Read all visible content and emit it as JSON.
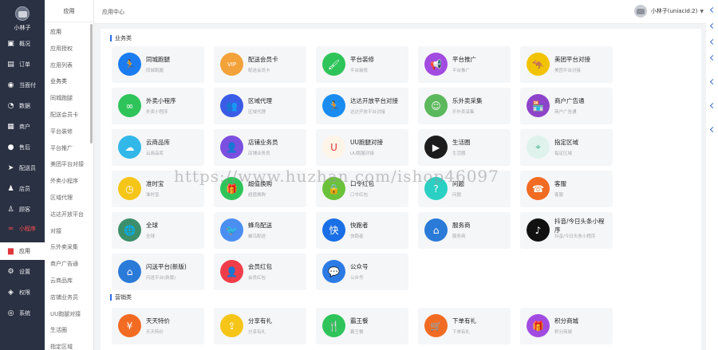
{
  "sidebar": {
    "username": "小林子",
    "items": [
      {
        "label": "概况",
        "icon": "overview-icon",
        "glyph": "▣",
        "style": ""
      },
      {
        "label": "订单",
        "icon": "order-icon",
        "glyph": "▤",
        "style": ""
      },
      {
        "label": "当面付",
        "icon": "face-pay-icon",
        "glyph": "◉",
        "style": ""
      },
      {
        "label": "数据",
        "icon": "data-icon",
        "glyph": "◔",
        "style": ""
      },
      {
        "label": "商户",
        "icon": "merchant-icon",
        "glyph": "▦",
        "style": ""
      },
      {
        "label": "售后",
        "icon": "after-sales-icon",
        "glyph": "●",
        "style": ""
      },
      {
        "label": "配送员",
        "icon": "courier-icon",
        "glyph": "➤",
        "style": ""
      },
      {
        "label": "店员",
        "icon": "clerk-icon",
        "glyph": "♟",
        "style": ""
      },
      {
        "label": "顾客",
        "icon": "customer-icon",
        "glyph": "♙",
        "style": ""
      },
      {
        "label": "小程序",
        "icon": "miniprogram-icon",
        "glyph": "∞",
        "style": "red"
      },
      {
        "label": "应用",
        "icon": "app-icon",
        "glyph": "▆",
        "style": "active"
      },
      {
        "label": "设置",
        "icon": "settings-icon",
        "glyph": "⚙",
        "style": ""
      },
      {
        "label": "权限",
        "icon": "permission-icon",
        "glyph": "◈",
        "style": ""
      },
      {
        "label": "系统",
        "icon": "system-icon",
        "glyph": "◎",
        "style": ""
      }
    ]
  },
  "submenu": {
    "header": "应用",
    "entries": [
      {
        "label": "应用",
        "kind": "cat"
      },
      {
        "label": "应用授权",
        "kind": "link"
      },
      {
        "label": "应用列表",
        "kind": "link"
      },
      {
        "label": "业务类",
        "kind": "cat"
      },
      {
        "label": "同城跑腿",
        "kind": "link"
      },
      {
        "label": "配送会员卡",
        "kind": "link"
      },
      {
        "label": "平台装修",
        "kind": "link"
      },
      {
        "label": "平台推广",
        "kind": "link"
      },
      {
        "label": "美团平台对接",
        "kind": "link"
      },
      {
        "label": "外卖小程序",
        "kind": "link"
      },
      {
        "label": "区域代理",
        "kind": "link"
      },
      {
        "label": "达达开放平台",
        "kind": "link"
      },
      {
        "label": "对接",
        "kind": "link"
      },
      {
        "label": "乐外卖采集",
        "kind": "link"
      },
      {
        "label": "商户广告通",
        "kind": "link"
      },
      {
        "label": "云商品库",
        "kind": "link"
      },
      {
        "label": "店铺业务员",
        "kind": "link"
      },
      {
        "label": "UU跑腿对接",
        "kind": "link"
      },
      {
        "label": "生活圈",
        "kind": "link"
      },
      {
        "label": "指定区域",
        "kind": "link"
      }
    ]
  },
  "topbar": {
    "title": "应用中心",
    "user": "小林子(uniacid:2)",
    "caret": "▼"
  },
  "sections": [
    {
      "title": "业务类"
    },
    {
      "title": "营销类"
    }
  ],
  "tiles": [
    {
      "name": "同城跑腿",
      "desc": "同城跑腿",
      "icon": "running-man-icon",
      "glyph": "🏃",
      "color": "#1a7cf0"
    },
    {
      "name": "配送会员卡",
      "desc": "配送会员卡",
      "icon": "vip-card-icon",
      "glyph": "VIP",
      "color": "#f3a23a"
    },
    {
      "name": "平台装修",
      "desc": "平台装修",
      "icon": "brush-icon",
      "glyph": "🖌",
      "color": "#2fc45a"
    },
    {
      "name": "平台推广",
      "desc": "平台推广",
      "icon": "megaphone-icon",
      "glyph": "📢",
      "color": "#a24be0"
    },
    {
      "name": "美团平台对接",
      "desc": "美团平台对接",
      "icon": "kangaroo-icon",
      "glyph": "🦘",
      "color": "#f2c300"
    },
    {
      "name": "外卖小程序",
      "desc": "外卖小程序",
      "icon": "miniprogram-logo-icon",
      "glyph": "∞",
      "color": "#2fc45a"
    },
    {
      "name": "区域代理",
      "desc": "区域代理",
      "icon": "agents-icon",
      "glyph": "👥",
      "color": "#3a5ce6"
    },
    {
      "name": "达达开放平台对接",
      "desc": "达达开放平台对接",
      "icon": "dada-icon",
      "glyph": "🏃",
      "color": "#1a8cf0"
    },
    {
      "name": "乐外卖采集",
      "desc": "乐外卖采集",
      "icon": "lewaimai-icon",
      "glyph": "☺",
      "color": "#5cb85c"
    },
    {
      "name": "商户广告通",
      "desc": "商户广告通",
      "icon": "store-ad-icon",
      "glyph": "🏪",
      "color": "#8e44c9"
    },
    {
      "name": "云商品库",
      "desc": "云商品库",
      "icon": "cloud-icon",
      "glyph": "☁",
      "color": "#32b8e8"
    },
    {
      "name": "店铺业务员",
      "desc": "店铺业务员",
      "icon": "salesman-icon",
      "glyph": "👤",
      "color": "#7b4fe0"
    },
    {
      "name": "UU跑腿对接",
      "desc": "UU跑腿对接",
      "icon": "magnet-icon",
      "glyph": "U",
      "color": "#fff4e8"
    },
    {
      "name": "生活圈",
      "desc": "生活圈",
      "icon": "play-circle-icon",
      "glyph": "▶",
      "color": "#1c1c1c"
    },
    {
      "name": "指定区域",
      "desc": "指定区域",
      "icon": "location-pin-icon",
      "glyph": "⌖",
      "color": "#dff3ec"
    },
    {
      "name": "准时宝",
      "desc": "准时宝",
      "icon": "clock-icon",
      "glyph": "◷",
      "color": "#f5c518"
    },
    {
      "name": "超值换购",
      "desc": "超值换购",
      "icon": "gift-icon",
      "glyph": "🎁",
      "color": "#2fc45a"
    },
    {
      "name": "口令红包",
      "desc": "口令红包",
      "icon": "lock-icon",
      "glyph": "🔒",
      "color": "#6bc23a"
    },
    {
      "name": "问题",
      "desc": "问题",
      "icon": "question-icon",
      "glyph": "?",
      "color": "#2ad0c4"
    },
    {
      "name": "客服",
      "desc": "客服",
      "icon": "service-icon",
      "glyph": "☎",
      "color": "#f26b22"
    },
    {
      "name": "全球",
      "desc": "全球",
      "icon": "globe-icon",
      "glyph": "🌐",
      "color": "#3c8f6b"
    },
    {
      "name": "蜂鸟配送",
      "desc": "蜂鸟配送",
      "icon": "hummingbird-icon",
      "glyph": "🐦",
      "color": "#4b8ef2"
    },
    {
      "name": "快跑者",
      "desc": "快跑者",
      "icon": "kuaipaozhe-icon",
      "glyph": "快",
      "color": "#1a6fe6"
    },
    {
      "name": "服务商",
      "desc": "服务商",
      "icon": "service-provider-icon",
      "glyph": "⌂",
      "color": "#2a7ad8"
    },
    {
      "name": "抖音/今日头条小程序",
      "desc": "抖音/今日头条小程序",
      "icon": "tiktok-icon",
      "glyph": "♪",
      "color": "#111"
    },
    {
      "name": "闪送平台(新版)",
      "desc": "闪送平台(新版)",
      "icon": "shansong-icon",
      "glyph": "⌂",
      "color": "#2a7ad8"
    },
    {
      "name": "会员红包",
      "desc": "会员红包",
      "icon": "red-packet-icon",
      "glyph": "👤",
      "color": "#ef3e4a"
    },
    {
      "name": "公众号",
      "desc": "公众号",
      "icon": "chat-icon",
      "glyph": "💬",
      "color": "#2c7be5"
    },
    {
      "name": "天天特价",
      "desc": "天天特价",
      "icon": "special-offer-icon",
      "glyph": "¥",
      "color": "#f26b22"
    },
    {
      "name": "分享有礼",
      "desc": "分享有礼",
      "icon": "share-icon",
      "glyph": "⇪",
      "color": "#f5c518"
    },
    {
      "name": "霸王餐",
      "desc": "霸王餐",
      "icon": "meal-icon",
      "glyph": "🍴",
      "color": "#2fc45a"
    },
    {
      "name": "下单有礼",
      "desc": "下单有礼",
      "icon": "cart-icon",
      "glyph": "🛒",
      "color": "#f26b22"
    },
    {
      "name": "积分商城",
      "desc": "积分商城",
      "icon": "points-mall-icon",
      "glyph": "🎁",
      "color": "#a24be0"
    }
  ],
  "watermark": "https://www.huzhan.com/ishop46097",
  "colors": {
    "accent": "#2b6ce6",
    "sidebar": "#2a3143",
    "danger": "#e0353d"
  }
}
